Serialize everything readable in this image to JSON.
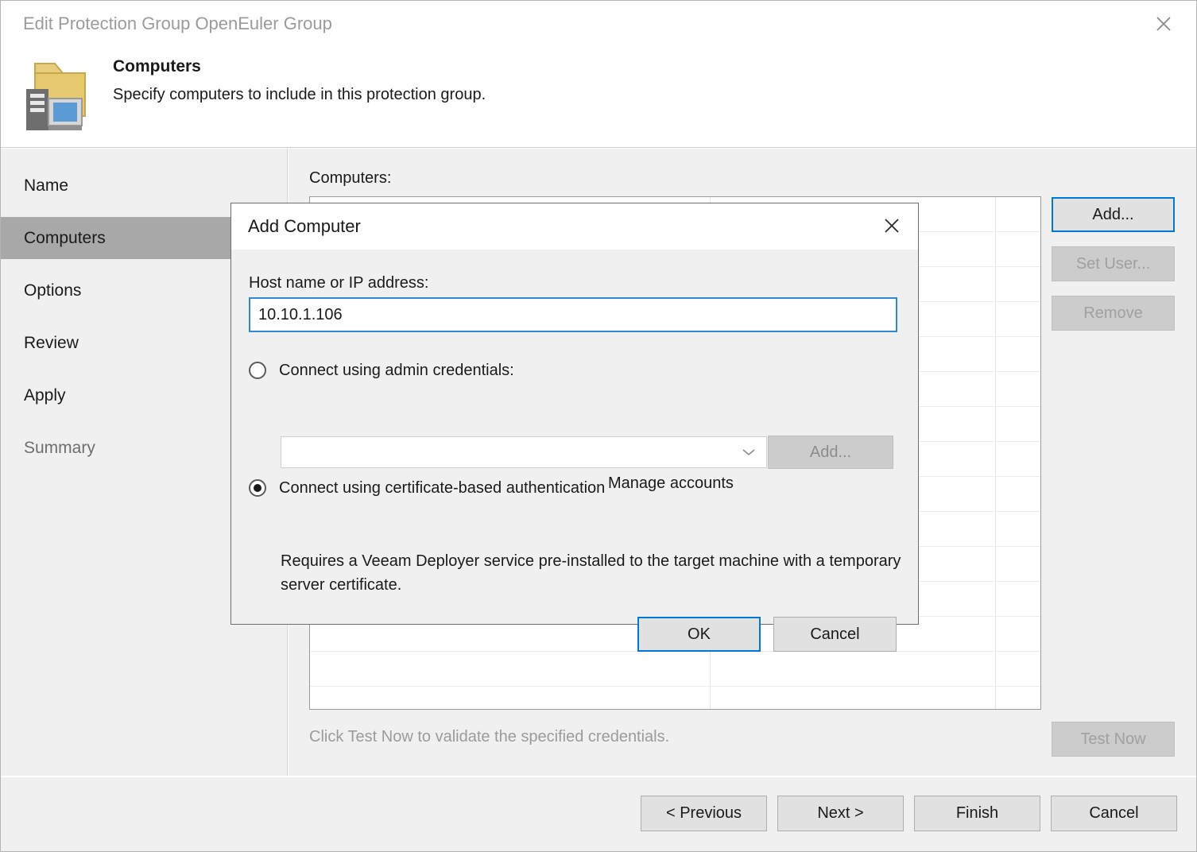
{
  "window": {
    "title": "Edit Protection Group OpenEuler Group",
    "close_icon": "close-icon"
  },
  "header": {
    "icon": "protection-group-computers-icon",
    "title": "Computers",
    "subtitle": "Specify computers to include in this protection group."
  },
  "sidebar": {
    "items": [
      {
        "label": "Name",
        "selected": false,
        "muted": false
      },
      {
        "label": "Computers",
        "selected": true,
        "muted": false
      },
      {
        "label": "Options",
        "selected": false,
        "muted": false
      },
      {
        "label": "Review",
        "selected": false,
        "muted": false
      },
      {
        "label": "Apply",
        "selected": false,
        "muted": false
      },
      {
        "label": "Summary",
        "selected": false,
        "muted": true
      }
    ]
  },
  "main": {
    "computers_label": "Computers:",
    "list": {
      "rows": [],
      "row_count": 14,
      "column_dividers": 2
    },
    "hint": "Click Test Now to validate the specified credentials.",
    "buttons": {
      "add": "Add...",
      "set_user": "Set User...",
      "remove": "Remove",
      "test_now": "Test Now"
    },
    "button_states": {
      "add": "enabled-focused",
      "set_user": "disabled",
      "remove": "disabled",
      "test_now": "disabled"
    }
  },
  "footer": {
    "previous": "< Previous",
    "next": "Next >",
    "finish": "Finish",
    "cancel": "Cancel"
  },
  "modal": {
    "title": "Add Computer",
    "close_icon": "close-icon",
    "host_label": "Host name or IP address:",
    "host_value": "10.10.1.106",
    "host_placeholder": "",
    "admin_radio": {
      "label": "Connect using admin credentials:",
      "selected": false
    },
    "credentials_combo": {
      "value": "",
      "placeholder": "",
      "arrow_icon": "chevron-down-icon"
    },
    "add_credentials_button": "Add...",
    "manage_accounts_link": "Manage accounts",
    "cert_radio": {
      "label": "Connect using certificate-based authentication",
      "selected": true,
      "description": "Requires a Veeam Deployer service pre-installed to the target machine with a temporary server certificate."
    },
    "ok_button": "OK",
    "cancel_button": "Cancel"
  },
  "colors": {
    "accent": "#0078d7",
    "input_focus_border": "#2d89d8",
    "selected_sidebar": "#a8a8a8",
    "panel_bg": "#f0f0f0",
    "folder_icon": "#e3c36a",
    "monitor_screen": "#5b9bd5",
    "tower": "#6e6e6e"
  }
}
